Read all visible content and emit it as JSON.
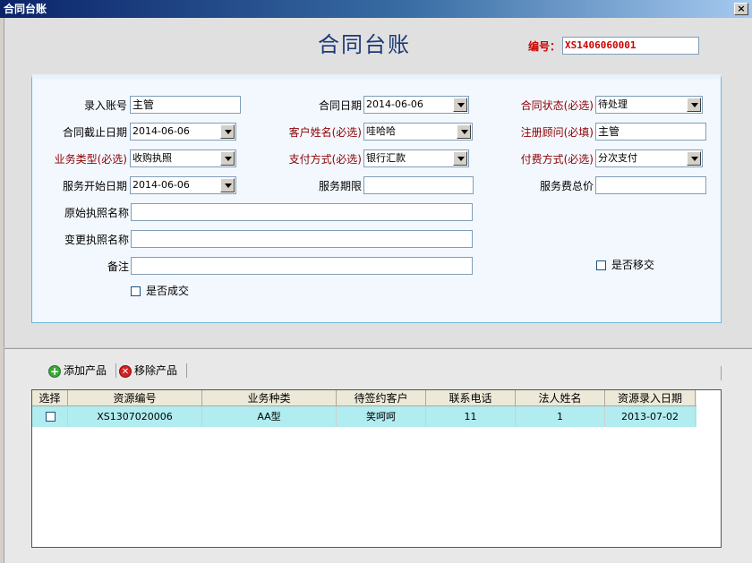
{
  "window": {
    "title": "合同台账",
    "close_glyph": "×"
  },
  "header": {
    "title": "合同台账",
    "bianhao_label": "编号：",
    "bianhao_value": "XS1406060001"
  },
  "form": {
    "luru_zhanghao_label": "录入账号",
    "luru_zhanghao_value": "主管",
    "hetong_riqi_label": "合同日期",
    "hetong_riqi_value": "2014-06-06",
    "hetong_zhuangtai_label": "合同状态(必选)",
    "hetong_zhuangtai_value": "待处理",
    "jiezhi_riqi_label": "合同截止日期",
    "jiezhi_riqi_value": "2014-06-06",
    "kehu_xingming_label": "客户姓名(必选)",
    "kehu_xingming_value": "哇哈哈",
    "zhuce_guwen_label": "注册顾问(必填)",
    "zhuce_guwen_value": "主管",
    "yewu_leixing_label": "业务类型(必选)",
    "yewu_leixing_value": "收购执照",
    "zhifu_fangshi_label": "支付方式(必选)",
    "zhifu_fangshi_value": "银行汇款",
    "fufei_fangshi_label": "付费方式(必选)",
    "fufei_fangshi_value": "分次支付",
    "fuwu_kaishi_label": "服务开始日期",
    "fuwu_kaishi_value": "2014-06-06",
    "fuwu_qixian_label": "服务期限",
    "fuwu_qixian_value": "",
    "fuwu_zongjia_label": "服务费总价",
    "fuwu_zongjia_value": "",
    "yuanshi_zhizhao_label": "原始执照名称",
    "yuanshi_zhizhao_value": "",
    "biangeng_zhizhao_label": "变更执照名称",
    "biangeng_zhizhao_value": "",
    "beizhu_label": "备注",
    "beizhu_value": "",
    "shifou_yijiao_label": "是否移交",
    "shifou_chengjiao_label": "是否成交"
  },
  "toolbar": {
    "add_label": "添加产品",
    "remove_label": "移除产品"
  },
  "grid": {
    "columns": [
      "选择",
      "资源编号",
      "业务种类",
      "待签约客户",
      "联系电话",
      "法人姓名",
      "资源录入日期"
    ],
    "rows": [
      [
        "",
        "XS1307020006",
        "AA型",
        "笑呵呵",
        "11",
        "1",
        "2013-07-02"
      ]
    ]
  },
  "colors": {
    "title_blue": "#1c3a78",
    "required_red": "#8b0000",
    "row_highlight": "#b0ecf0"
  }
}
